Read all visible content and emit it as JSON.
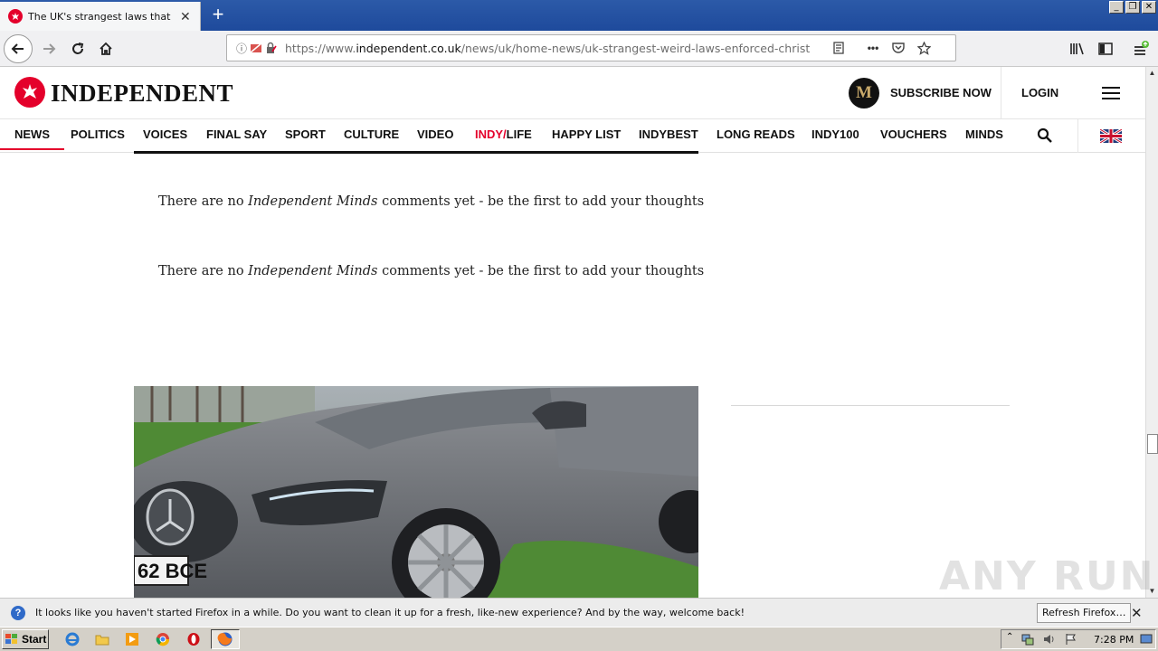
{
  "browser": {
    "tab_title": "The UK's strangest laws that are s",
    "url_prefix": "https://www.",
    "url_domain": "independent.co.uk",
    "url_path": "/news/uk/home-news/uk-strangest-weird-laws-enforced-christopher-"
  },
  "site": {
    "logo_text": "INDEPENDENT",
    "subscribe_badge": "M",
    "subscribe_label": "SUBSCRIBE NOW",
    "login_label": "LOGIN",
    "nav": [
      {
        "label": "NEWS"
      },
      {
        "label": "POLITICS"
      },
      {
        "label": "VOICES"
      },
      {
        "label": "FINAL SAY"
      },
      {
        "label": "SPORT"
      },
      {
        "label": "CULTURE"
      },
      {
        "label": "VIDEO"
      },
      {
        "label_red": "INDY/",
        "label": "LIFE"
      },
      {
        "label": "HAPPY LIST"
      },
      {
        "label": "INDYBEST"
      },
      {
        "label": "LONG READS"
      },
      {
        "label": "INDY100"
      },
      {
        "label": "VOUCHERS"
      },
      {
        "label": "MINDS"
      }
    ]
  },
  "content": {
    "comments_1": {
      "pre": "There are no ",
      "em": "Independent Minds",
      "post": " comments yet - be the first to add your thoughts"
    },
    "comments_2": {
      "pre": "There are no ",
      "em": "Independent Minds",
      "post": " comments yet - be the first to add your thoughts"
    },
    "plate_text": "62 BCE"
  },
  "watermark": "ANY RUN",
  "notification": {
    "text": "It looks like you haven't started Firefox in a while. Do you want to clean it up for a fresh, like-new experience? And by the way, welcome back!",
    "button": "Refresh Firefox…"
  },
  "taskbar": {
    "start_label": "Start",
    "clock": "7:28 PM"
  },
  "colors": {
    "brand_red": "#e4002b",
    "titlebar_blue": "#1e4a9c"
  }
}
